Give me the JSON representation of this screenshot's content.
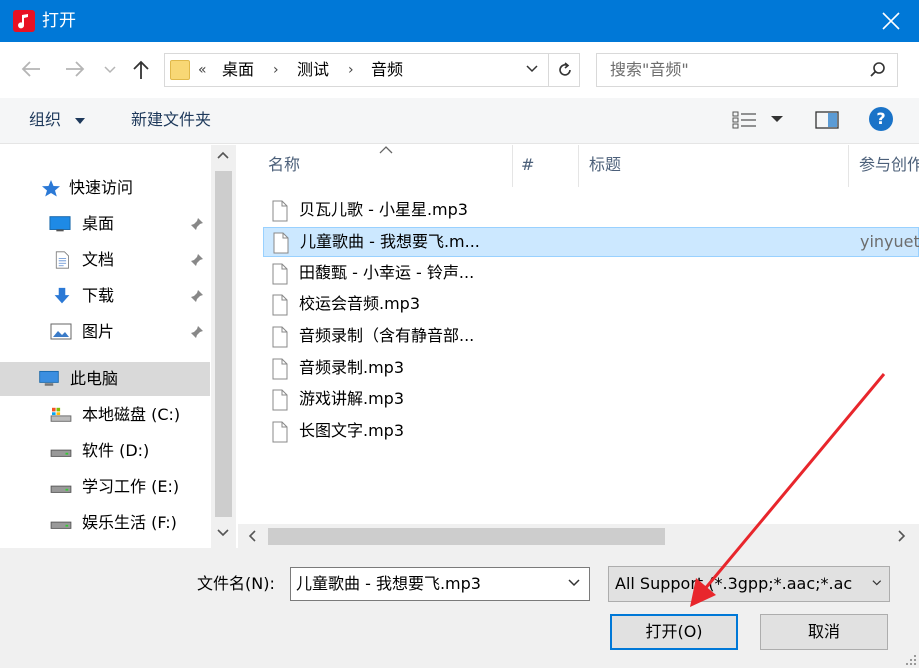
{
  "window": {
    "title": "打开"
  },
  "address": {
    "overflow": "«",
    "crumbs": [
      "桌面",
      "测试",
      "音频"
    ]
  },
  "search": {
    "placeholder": "搜索\"音频\""
  },
  "toolbar": {
    "organize": "组织",
    "new_folder": "新建文件夹",
    "help": "?"
  },
  "nav": {
    "quick_access": "快速访问",
    "items": [
      {
        "label": "桌面",
        "icon": "desktop-icon",
        "pinned": true
      },
      {
        "label": "文档",
        "icon": "document-icon",
        "pinned": true
      },
      {
        "label": "下载",
        "icon": "download-icon",
        "pinned": true
      },
      {
        "label": "图片",
        "icon": "pictures-icon",
        "pinned": true
      }
    ],
    "this_pc": "此电脑",
    "drives": [
      "本地磁盘 (C:)",
      "软件 (D:)",
      "学习工作 (E:)",
      "娱乐生活 (F:)"
    ]
  },
  "columns": [
    "名称",
    "#",
    "标题",
    "参与创作"
  ],
  "files": [
    {
      "name": "贝瓦儿歌 - 小星星.mp3",
      "artist": ""
    },
    {
      "name": "儿童歌曲 - 我想要飞.m...",
      "artist": "yinyuet",
      "selected": true
    },
    {
      "name": "田馥甄 - 小幸运 - 铃声...",
      "artist": ""
    },
    {
      "name": "校运会音频.mp3",
      "artist": ""
    },
    {
      "name": "音频录制（含有静音部...",
      "artist": ""
    },
    {
      "name": "音频录制.mp3",
      "artist": ""
    },
    {
      "name": "游戏讲解.mp3",
      "artist": ""
    },
    {
      "name": "长图文字.mp3",
      "artist": ""
    }
  ],
  "footer": {
    "filename_label": "文件名(N):",
    "filename_value": "儿童歌曲 - 我想要飞.mp3",
    "filetype_value": "All Support (*.3gpp;*.aac;*.ac",
    "open_button": "打开(O)",
    "cancel_button": "取消"
  },
  "colors": {
    "titlebar": "#0078d7",
    "selection": "#cce8ff",
    "annotation_arrow": "#e8262c"
  }
}
